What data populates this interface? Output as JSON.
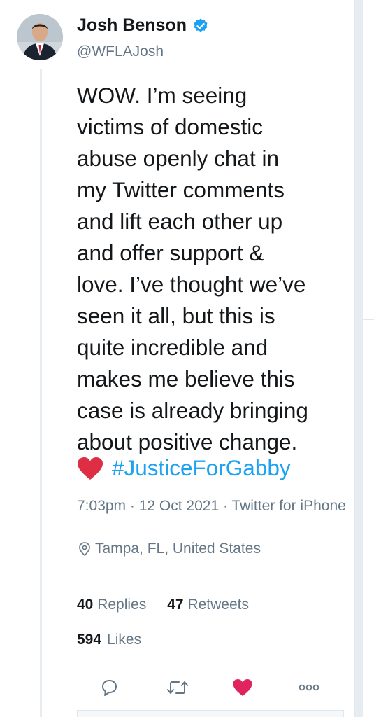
{
  "author": {
    "display_name": "Josh Benson",
    "handle": "@WFLAJosh",
    "verified": true
  },
  "tweet": {
    "text": "WOW. I’m seeing\nvictims of domestic\nabuse openly chat in\nmy Twitter comments\nand lift each other up\nand offer support &\nlove. I’ve thought we’ve\nseen it all, but this is\nquite incredible and\nmakes me believe this\ncase is already bringing\nabout positive change.",
    "emoji": "red-heart",
    "hashtag": "#JusticeForGabby"
  },
  "meta": {
    "timestamp_source": "7:03pm · 12 Oct 2021 · Twitter for iPhone",
    "location": "Tampa, FL, United States"
  },
  "stats": {
    "replies_count": "40",
    "replies_label": "Replies",
    "retweets_count": "47",
    "retweets_label": "Retweets",
    "likes_count": "594",
    "likes_label": "Likes"
  },
  "actions": {
    "reply_icon": "reply-icon",
    "retweet_icon": "retweet-icon",
    "like_icon": "heart-icon",
    "more_icon": "more-icon",
    "liked": true
  },
  "colors": {
    "text": "#14171a",
    "secondary": "#657786",
    "link": "#1da1f2",
    "verified": "#1da1f2",
    "like": "#e0245e",
    "divider": "#e1e8ed"
  }
}
